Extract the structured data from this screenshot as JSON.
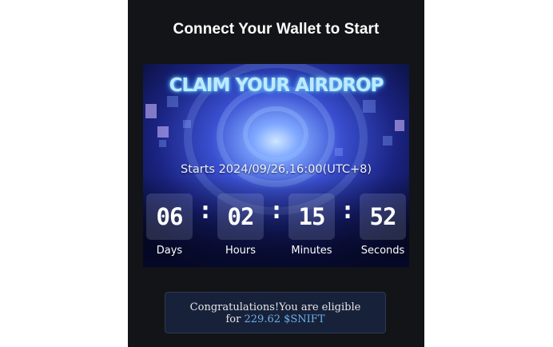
{
  "heading": "Connect Your Wallet to Start",
  "banner": {
    "title": "CLAIM YOUR AIRDROP",
    "starts": "Starts 2024/09/26,16:00(UTC+8)",
    "countdown": [
      {
        "value": "06",
        "label": "Days"
      },
      {
        "value": "02",
        "label": "Hours"
      },
      {
        "value": "15",
        "label": "Minutes"
      },
      {
        "value": "52",
        "label": "Seconds"
      }
    ],
    "separator": ":"
  },
  "message": {
    "line1": "Congratulations!You are eligible",
    "prefix": "for",
    "amount": "229.62 $SNIFT"
  },
  "colors": {
    "panel": "#131417",
    "accent": "#6db1e8"
  }
}
